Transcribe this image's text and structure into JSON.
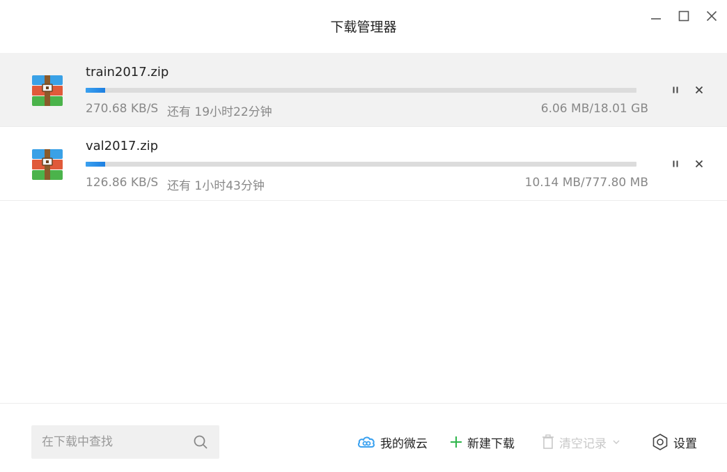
{
  "window": {
    "title": "下载管理器"
  },
  "downloads": [
    {
      "name": "train2017.zip",
      "speed": "270.68 KB/S",
      "remaining": "还有 19小时22分钟",
      "size": "6.06 MB/18.01 GB",
      "progress": 0.036,
      "selected": true
    },
    {
      "name": "val2017.zip",
      "speed": "126.86 KB/S",
      "remaining": "还有 1小时43分钟",
      "size": "10.14 MB/777.80 MB",
      "progress": 0.036,
      "selected": false
    }
  ],
  "footer": {
    "search_placeholder": "在下载中查找",
    "weiyun_label": "我的微云",
    "new_download_label": "新建下载",
    "clear_records_label": "清空记录",
    "settings_label": "设置"
  },
  "colors": {
    "accent": "#1e7fe0",
    "weiyun": "#3aa1f0",
    "new_download": "#2db54a",
    "disabled": "#c8c8c8",
    "selected_row": "#f2f2f2"
  },
  "icons": {
    "file": "archive-icon",
    "pause": "pause-icon",
    "remove": "close-icon",
    "search": "search-icon",
    "weiyun": "cloud-icon",
    "new_download": "plus-icon",
    "clear": "trash-icon",
    "settings": "gear-icon"
  }
}
